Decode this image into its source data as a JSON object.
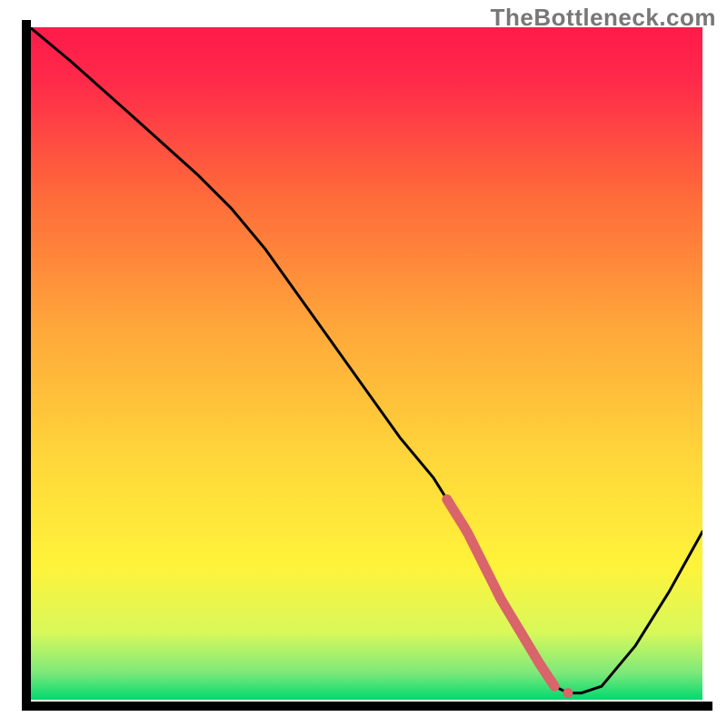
{
  "watermark": "TheBottleneck.com",
  "colors": {
    "gradient_top": "#ff1a4a",
    "gradient_mid": "#ffd400",
    "gradient_bottom": "#00d96f",
    "curve": "#000000",
    "marker": "#d9646a",
    "axis": "#000000"
  },
  "chart_data": {
    "type": "line",
    "title": "",
    "xlabel": "",
    "ylabel": "",
    "xlim": [
      0,
      100
    ],
    "ylim": [
      0,
      100
    ],
    "grid": false,
    "legend": false,
    "series": [
      {
        "name": "bottleneck-curve",
        "x": [
          0,
          6,
          15,
          25,
          30,
          35,
          40,
          45,
          50,
          55,
          60,
          65,
          68,
          70,
          73,
          76,
          78,
          80,
          82,
          85,
          90,
          95,
          100
        ],
        "y": [
          100,
          95,
          87,
          78,
          73,
          67,
          60,
          53,
          46,
          39,
          33,
          25,
          19,
          15,
          10,
          5,
          2,
          1,
          1,
          2,
          8,
          16,
          25
        ]
      }
    ],
    "markers": [
      {
        "name": "highlight-segment",
        "x_range": [
          62,
          78
        ],
        "thickness": 11
      },
      {
        "name": "highlight-dot",
        "x": 80,
        "thickness": 11
      }
    ]
  }
}
